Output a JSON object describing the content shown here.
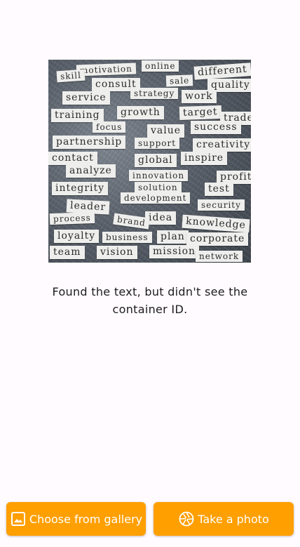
{
  "illustration": {
    "description_words": [
      "motivation",
      "online",
      "skill",
      "different",
      "sale",
      "consult",
      "quality",
      "service",
      "strategy",
      "work",
      "training",
      "growth",
      "target",
      "trade",
      "focus",
      "value",
      "success",
      "partnership",
      "support",
      "creativity",
      "contact",
      "global",
      "inspire",
      "analyze",
      "innovation",
      "profit",
      "integrity",
      "solution",
      "test",
      "development",
      "leader",
      "security",
      "process",
      "idea",
      "brand",
      "knowledge",
      "loyalty",
      "business",
      "plan",
      "corporate",
      "team",
      "vision",
      "mission",
      "network"
    ]
  },
  "message": "Found the text, but didn't see the container ID.",
  "actions": {
    "gallery_label": "Choose from gallery",
    "photo_label": "Take a photo"
  },
  "colors": {
    "accent": "#ff9f00",
    "background": "#fffbfe",
    "text": "#1c1b1f"
  }
}
